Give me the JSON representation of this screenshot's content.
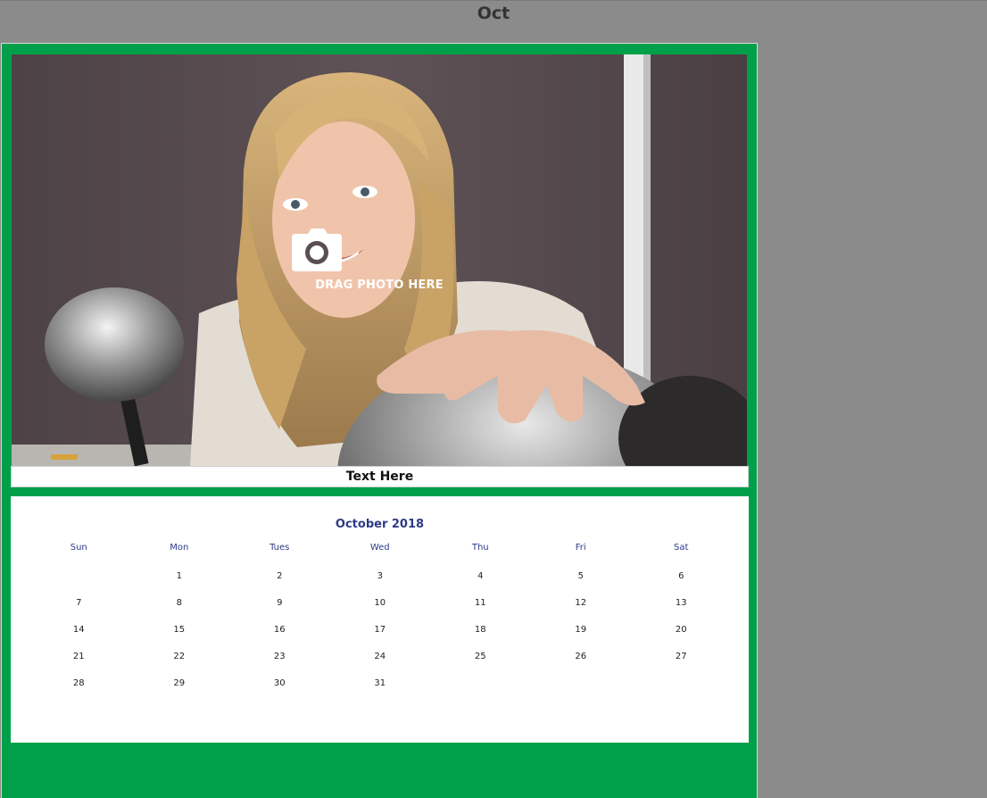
{
  "header": {
    "month": "Oct"
  },
  "photo": {
    "drag_label": "DRAG PHOTO HERE"
  },
  "caption": {
    "text": "Text Here"
  },
  "calendar": {
    "title": "October 2018",
    "weekdays": [
      "Sun",
      "Mon",
      "Tues",
      "Wed",
      "Thu",
      "Fri",
      "Sat"
    ],
    "weeks": [
      [
        "",
        "1",
        "2",
        "3",
        "4",
        "5",
        "6"
      ],
      [
        "7",
        "8",
        "9",
        "10",
        "11",
        "12",
        "13"
      ],
      [
        "14",
        "15",
        "16",
        "17",
        "18",
        "19",
        "20"
      ],
      [
        "21",
        "22",
        "23",
        "24",
        "25",
        "26",
        "27"
      ],
      [
        "28",
        "29",
        "30",
        "31",
        "",
        "",
        ""
      ]
    ]
  },
  "colors": {
    "frame": "#00a04a",
    "title_text": "#2e3a87",
    "background": "#8b8b8b"
  },
  "icons": {
    "camera": "camera-icon"
  }
}
